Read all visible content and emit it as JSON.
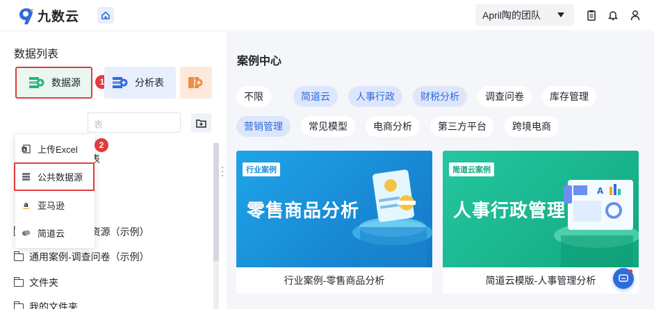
{
  "header": {
    "app_name": "九数云",
    "team": "April陶的团队"
  },
  "left": {
    "title": "数据列表",
    "tabs": {
      "datasource": "数据源",
      "analysis": "分析表"
    },
    "badges": [
      "1",
      "2"
    ],
    "search_placeholder": "表",
    "dropdown": [
      {
        "label": "上传Excel",
        "icon": "excel-icon"
      },
      {
        "label": "公共数据源",
        "icon": "database-icon"
      },
      {
        "label": "亚马逊",
        "icon": "amazon-icon"
      },
      {
        "label": "简道云",
        "icon": "jiandaoyun-icon"
      }
    ],
    "ghost_text": "表",
    "tree": [
      "通用案例-人力资源（示例）",
      "通用案例-调查问卷（示例）",
      "文件夹",
      "我的文件夹"
    ]
  },
  "right": {
    "title": "案例中心",
    "tags_row1": [
      "不限",
      "简道云",
      "人事行政",
      "财税分析",
      "调查问卷",
      "库存管理"
    ],
    "tags_row2": [
      "营销管理",
      "常见模型",
      "电商分析",
      "第三方平台",
      "跨境电商"
    ],
    "cards": [
      {
        "badge": "行业案例",
        "headline": "零售商品分析",
        "caption": "行业案例-零售商品分析",
        "color": "#1b8fd8"
      },
      {
        "badge": "简道云案例",
        "headline": "人事行政管理",
        "caption": "简道云模版-人事管理分析",
        "color": "#17b58d"
      }
    ]
  },
  "colors": {
    "accent": "#2f6bdb",
    "highlight": "#e03c3c",
    "tag_selected_bg": "#dde6fb"
  }
}
